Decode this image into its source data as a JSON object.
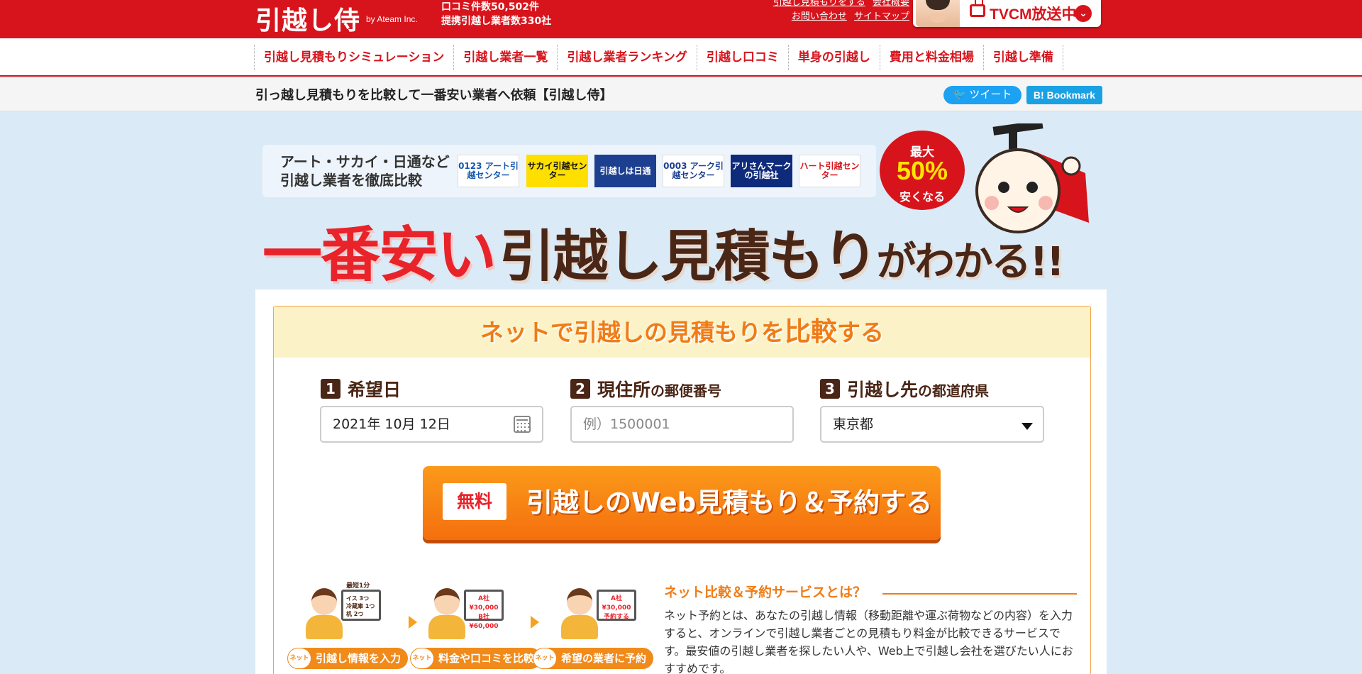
{
  "header": {
    "logo": "引越し侍",
    "logo_by": "by Ateam Inc.",
    "stats": [
      "口コミ件数50,502件",
      "提携引越し業者数330社"
    ],
    "links_row1": [
      "引越し見積もりをする",
      "会社概要"
    ],
    "links_row2": [
      "お問い合わせ",
      "サイトマップ"
    ],
    "tvcm_label": "TVCM放送中",
    "tvcm_icon": "chevron-down-icon"
  },
  "nav": {
    "items": [
      "引越し見積もりシミュレーション",
      "引越し業者一覧",
      "引越し業者ランキング",
      "引越し口コミ",
      "単身の引越し",
      "費用と料金相場",
      "引越し準備"
    ]
  },
  "titlebar": {
    "title": "引っ越し見積もりを比較して一番安い業者へ依頼【引越し侍】",
    "tweet": "ツイート",
    "bookmark": "B! Bookmark"
  },
  "hero": {
    "companies_line1": "アート・サカイ・日通など",
    "companies_line2": "引越し業者を徹底比較",
    "company_logos": [
      "0123 アート引越センター",
      "サカイ引越センター",
      "引越しは日通",
      "0003 アーク引越センター",
      "アリさんマークの引越社",
      "ハート引越センター"
    ],
    "badge_line1": "最大",
    "badge_line2": "50%",
    "badge_line3": "安くなる",
    "headline_red": "一番安い",
    "headline_dark": "引越し見積もり",
    "headline_tail": "がわかる!!"
  },
  "form": {
    "title_a": "ネットで引越しの見積もりを",
    "title_b": "比較",
    "title_c": "する",
    "step1_num": "1",
    "step1_label": "希望日",
    "step1_value": "2021年 10月 12日",
    "step2_num": "2",
    "step2_label_a": "現住所",
    "step2_label_b": "の郵便番号",
    "step2_placeholder": "例）1500001",
    "step3_num": "3",
    "step3_label_a": "引越し先",
    "step3_label_b": "の都道府県",
    "step3_value": "東京都",
    "cta_free": "無料",
    "cta_label": "引越しのWeb見積もり＆予約する"
  },
  "howto": {
    "step1_caption": "引越し情報を入力",
    "step1_badge": "最短1分",
    "step1_screen": [
      "イス 3つ",
      "冷蔵庫 1つ",
      "机 2つ"
    ],
    "step2_caption": "料金や口コミを比較",
    "step2_screen": [
      "A社 ¥30,000",
      "B社 ¥60,000"
    ],
    "step3_caption": "希望の業者に予約",
    "step3_screen": [
      "A社",
      "¥30,000",
      "予約する"
    ],
    "info_title": "ネット比較＆予約サービスとは？",
    "info_body": "ネット予約とは、あなたの引越し情報（移動距離や運ぶ荷物などの内容）を入力すると、オンラインで引越し業者ごとの見積もり料金が比較できるサービスです。最安値の引越し業者を探したい人や、Web上で引越し会社を選びたい人におすすめです。"
  }
}
